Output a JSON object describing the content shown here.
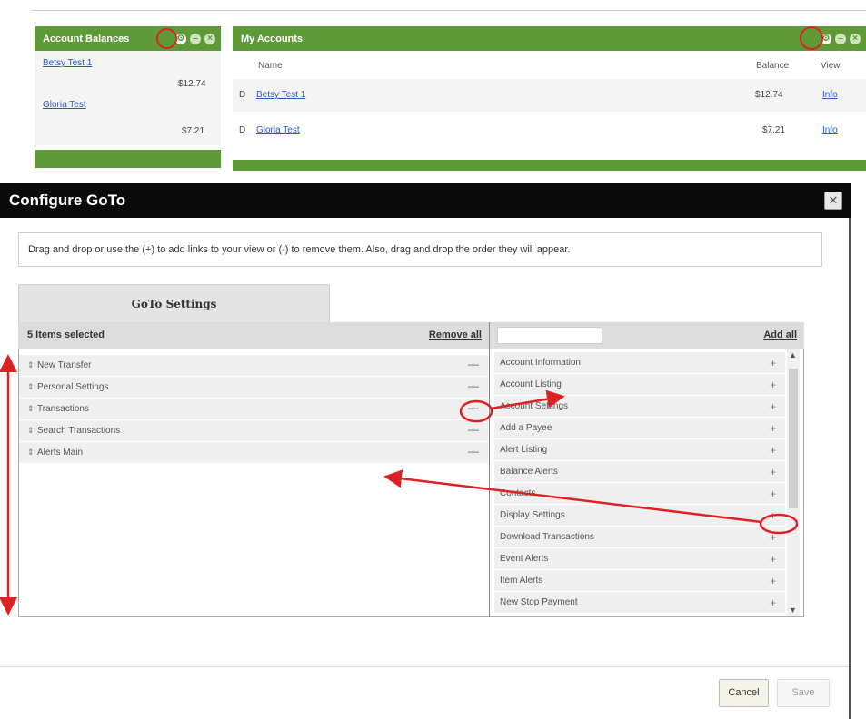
{
  "dashboard": {
    "account_balances": {
      "title": "Account Balances",
      "accounts": [
        {
          "name": "Betsy Test 1",
          "balance": "$12.74"
        },
        {
          "name": "Gloria Test",
          "balance": "$7.21"
        }
      ]
    },
    "my_accounts": {
      "title": "My Accounts",
      "columns": {
        "name": "Name",
        "balance": "Balance",
        "view": "View"
      },
      "rows": [
        {
          "type": "D",
          "name": "Betsy Test 1",
          "balance": "$12.74",
          "view": "Info"
        },
        {
          "type": "D",
          "name": "Gloria Test",
          "balance": "$7.21",
          "view": "Info"
        }
      ]
    },
    "header_icons": [
      "settings-icon",
      "minimize-icon",
      "close-icon"
    ]
  },
  "modal": {
    "title": "Configure GoTo",
    "close_glyph": "✕",
    "instructions": "Drag and drop or use the (+) to add links to your view or (-) to remove them. Also, drag and drop the order they will appear.",
    "tab_label": "GoTo Settings",
    "selected": {
      "count_label": "5 Items selected",
      "remove_all": "Remove all",
      "items": [
        "New Transfer",
        "Personal Settings",
        "Transactions",
        "Search Transactions",
        "Alerts Main"
      ]
    },
    "available": {
      "search_placeholder": "",
      "add_all": "Add all",
      "items": [
        "Account Information",
        "Account Listing",
        "Account Settings",
        "Add a Payee",
        "Alert Listing",
        "Balance Alerts",
        "Contacts",
        "Display Settings",
        "Download Transactions",
        "Event Alerts",
        "Item Alerts",
        "New Stop Payment"
      ]
    },
    "buttons": {
      "cancel": "Cancel",
      "save": "Save"
    }
  },
  "colors": {
    "header_green": "#5e9a35",
    "modal_title_bg": "#0a0a0a",
    "annotation_red": "#dd2222",
    "link_blue": "#2a56c6"
  }
}
